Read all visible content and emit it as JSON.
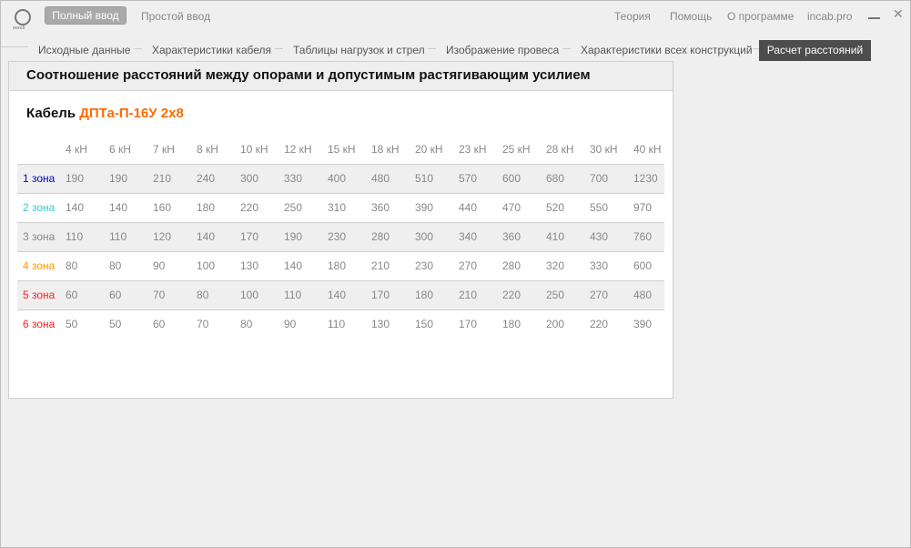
{
  "header": {
    "logo_text": "инкаб",
    "mode_full": "Полный ввод",
    "mode_simple": "Простой ввод",
    "links": [
      "Теория",
      "Помощь",
      "О программе",
      "incab.pro"
    ]
  },
  "tabs": [
    "Исходные данные",
    "Характеристики кабеля",
    "Таблицы нагрузок и стрел",
    "Изображение провеса",
    "Характеристики всех конструкций",
    "Расчет расстояний"
  ],
  "panel": {
    "title": "Соотношение расстояний между опорами и допустимым растягивающим усилием",
    "cable_label": "Кабель",
    "cable_name": "ДПТа-П-16У 2х8"
  },
  "table": {
    "columns": [
      "4 кН",
      "6 кН",
      "7 кН",
      "8 кН",
      "10 кН",
      "12 кН",
      "15 кН",
      "18 кН",
      "20 кН",
      "23 кН",
      "25 кН",
      "28 кН",
      "30 кН",
      "40 кН"
    ],
    "rows": [
      {
        "zone": "1 зона",
        "color": "#0000cc",
        "values": [
          "190",
          "190",
          "210",
          "240",
          "300",
          "330",
          "400",
          "480",
          "510",
          "570",
          "600",
          "680",
          "700",
          "1230"
        ]
      },
      {
        "zone": "2 зона",
        "color": "#33cccc",
        "values": [
          "140",
          "140",
          "160",
          "180",
          "220",
          "250",
          "310",
          "360",
          "390",
          "440",
          "470",
          "520",
          "550",
          "970"
        ]
      },
      {
        "zone": "3 зона",
        "color": "#888888",
        "values": [
          "110",
          "110",
          "120",
          "140",
          "170",
          "190",
          "230",
          "280",
          "300",
          "340",
          "360",
          "410",
          "430",
          "760"
        ]
      },
      {
        "zone": "4 зона",
        "color": "#ff9900",
        "values": [
          "80",
          "80",
          "90",
          "100",
          "130",
          "140",
          "180",
          "210",
          "230",
          "270",
          "280",
          "320",
          "330",
          "600"
        ]
      },
      {
        "zone": "5 зона",
        "color": "#ff2020",
        "values": [
          "60",
          "60",
          "70",
          "80",
          "100",
          "110",
          "140",
          "170",
          "180",
          "210",
          "220",
          "250",
          "270",
          "480"
        ]
      },
      {
        "zone": "6 зона",
        "color": "#ff2020",
        "values": [
          "50",
          "50",
          "60",
          "70",
          "80",
          "90",
          "110",
          "130",
          "150",
          "170",
          "180",
          "200",
          "220",
          "390"
        ]
      }
    ]
  }
}
